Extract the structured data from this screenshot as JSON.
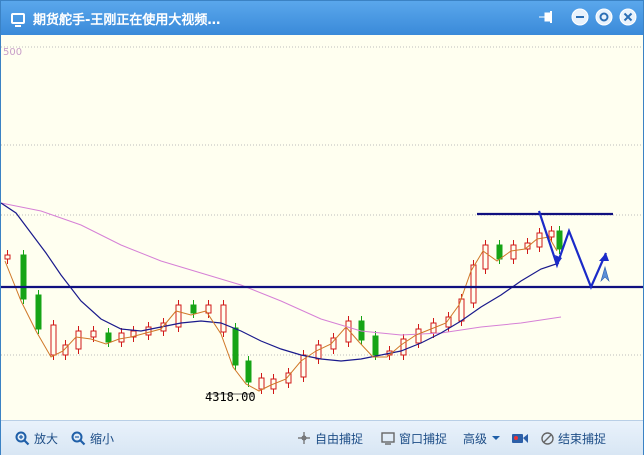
{
  "window": {
    "title": "期货舵手-王刚正在使用大视频…",
    "icon": "monitor-icon",
    "buttons": [
      "pin-icon",
      "minimize-icon",
      "maximize-icon",
      "close-icon"
    ],
    "accent": "#3a8ad9"
  },
  "chart": {
    "corner_label": "500",
    "low_price_label": "4318.00",
    "horizontal_lines": [
      "support",
      "resistance"
    ],
    "colors": {
      "up": "#d01818",
      "down": "#16a416",
      "ma_fast": "#d07828",
      "ma_mid": "#1a1a8c",
      "ma_slow": "#d680d6",
      "level": "#101080",
      "grid": "#bdbdbd"
    }
  },
  "statusbar": {
    "zoom_in": "放大",
    "zoom_out": "缩小",
    "free_capture": "自由捕捉",
    "window_capture": "窗口捕捉",
    "advanced": "高级",
    "end_capture": "结束捕捉"
  }
}
